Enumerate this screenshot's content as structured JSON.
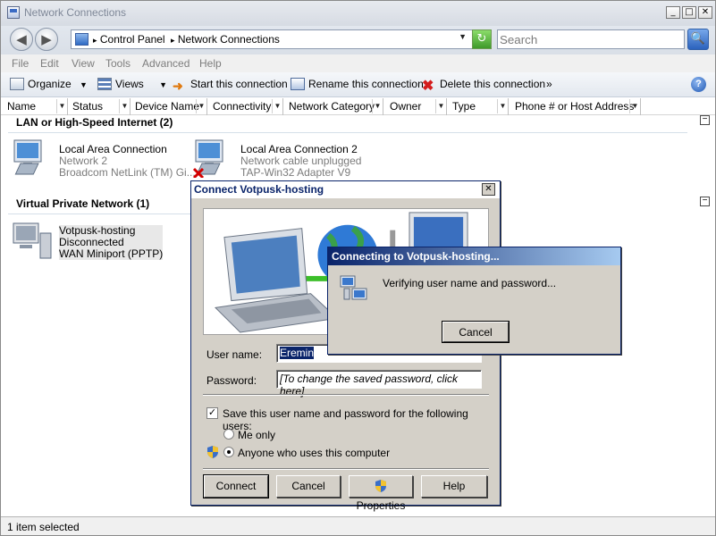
{
  "window": {
    "title": "Network Connections"
  },
  "caption_buttons": {
    "minimize": "_",
    "maximize": "□",
    "close": "✕"
  },
  "address": {
    "path": [
      "Control Panel",
      "Network Connections"
    ],
    "separator": "▸"
  },
  "search": {
    "placeholder": "Search"
  },
  "menu": [
    "File",
    "Edit",
    "View",
    "Tools",
    "Advanced",
    "Help"
  ],
  "toolbar": {
    "organize": "Organize",
    "views": "Views",
    "start": "Start this connection",
    "rename": "Rename this connection",
    "delete": "Delete this connection",
    "more": "»"
  },
  "columns": [
    "Name",
    "Status",
    "Device Name",
    "Connectivity",
    "Network Category",
    "Owner",
    "Type",
    "Phone # or Host Address"
  ],
  "groups": [
    {
      "title": "LAN or High-Speed Internet (2)",
      "items": [
        {
          "name": "Local Area Connection",
          "line2": "Network  2",
          "line3": "Broadcom NetLink (TM) Gi..."
        },
        {
          "name": "Local Area Connection 2",
          "line2": "Network cable unplugged",
          "line3": "TAP-Win32 Adapter V9"
        }
      ]
    },
    {
      "title": "Virtual Private Network (1)",
      "items": [
        {
          "name": "Votpusk-hosting",
          "line2": "Disconnected",
          "line3": "WAN Miniport (PPTP)"
        }
      ]
    }
  ],
  "status_bar": {
    "text": "1 item selected"
  },
  "connect_dialog": {
    "title": "Connect Votpusk-hosting",
    "username_label": "User name:",
    "username_value": "Eremin",
    "password_label": "Password:",
    "password_value": "[To change the saved password, click here]",
    "save_label": "Save this user name and password for the following users:",
    "save_checked": true,
    "me_only": "Me only",
    "anyone": "Anyone who uses this computer",
    "connect_btn": "Connect",
    "cancel_btn": "Cancel",
    "properties_btn": "Properties",
    "help_btn": "Help"
  },
  "progress_dialog": {
    "title": "Connecting to Votpusk-hosting...",
    "message": "Verifying user name and password...",
    "cancel_btn": "Cancel"
  }
}
